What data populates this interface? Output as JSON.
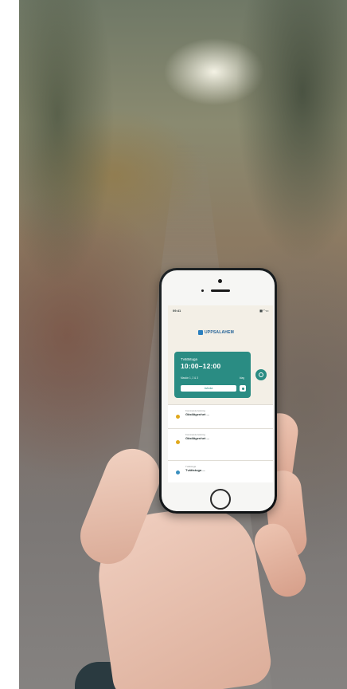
{
  "app": {
    "status_time": "09:41",
    "status_icons": "▮▮ ◠ ▭",
    "logo_text": "UPPSALAHEM"
  },
  "booking_card": {
    "label": "Tvättstuga",
    "time": "10:00–12:00",
    "meta_left": "Maskin 1, 2 & 3",
    "meta_right": "Idag",
    "button_label": "Avboka"
  },
  "list": [
    {
      "small": "Kommande bokning",
      "title": "Gästlägenhet ...",
      "row_left": "",
      "row_right": "",
      "corner": "",
      "dot_color": "#e0a81c"
    },
    {
      "small": "Kommande bokning",
      "title": "Gästlägenhet ...",
      "row_left": "",
      "row_right": "",
      "corner": "",
      "dot_color": "#e0a81c"
    },
    {
      "small": "Tvättstuga",
      "title": "Tvättstuga ...",
      "row_left": "",
      "row_right": "",
      "corner": "",
      "dot_color": "#3a8fbf"
    }
  ],
  "colors": {
    "accent": "#2a8c83",
    "brand": "#1f5f95"
  },
  "icons": {
    "fab": "lock-icon",
    "card_small_button": "plus-icon"
  }
}
